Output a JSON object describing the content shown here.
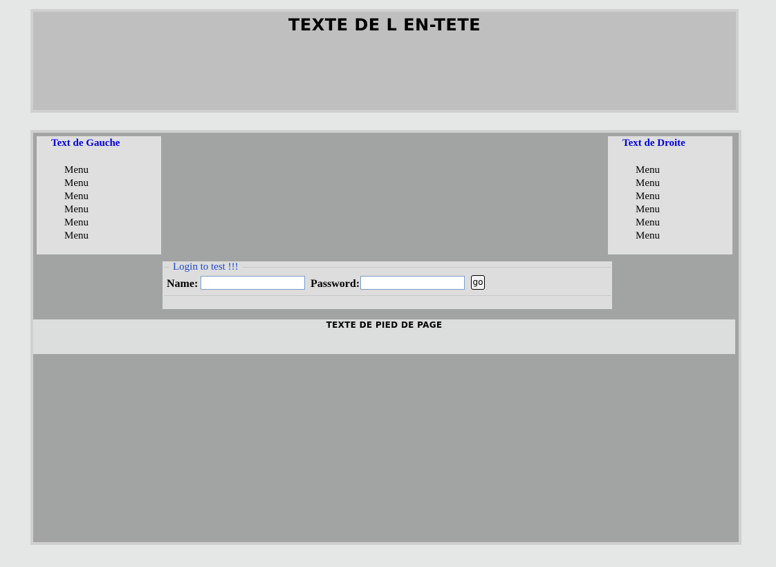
{
  "header": {
    "title": "TEXTE DE L EN-TETE"
  },
  "left_panel": {
    "title": "Text de Gauche",
    "menu": [
      "Menu",
      "Menu",
      "Menu",
      "Menu",
      "Menu",
      "Menu"
    ]
  },
  "right_panel": {
    "title": "Text de Droite",
    "menu": [
      "Menu",
      "Menu",
      "Menu",
      "Menu",
      "Menu",
      "Menu"
    ]
  },
  "login": {
    "legend": "Login to test !!!",
    "name_label": "Name:",
    "name_value": "",
    "password_label": "Password:",
    "password_value": "",
    "go_label": "go"
  },
  "footer": {
    "text": "TEXTE DE PIED DE PAGE"
  },
  "colors": {
    "page_background": "#e5e7e6",
    "header_background": "#bfbfbf",
    "main_background": "#a2a4a3",
    "panel_background": "#dedfde",
    "panel_title": "#0000dd",
    "legend": "#1e46d6"
  }
}
